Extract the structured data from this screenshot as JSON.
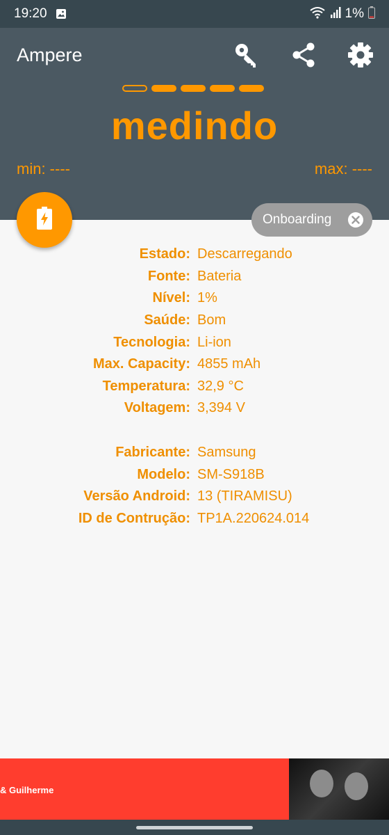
{
  "status_bar": {
    "time": "19:20",
    "battery_percent": "1%"
  },
  "header": {
    "app_title": "Ampere",
    "icons": [
      "key-icon",
      "share-icon",
      "gear-icon"
    ],
    "progress": {
      "filled": 4,
      "total": 5
    },
    "status_word": "medindo",
    "min_label": "min: ----",
    "max_label": "max: ----"
  },
  "fab": {
    "icon": "battery-charging-icon"
  },
  "chip": {
    "label": "Onboarding",
    "icon": "close-circle-icon"
  },
  "battery_info": [
    {
      "label": "Estado:",
      "value": "Descarregando"
    },
    {
      "label": "Fonte:",
      "value": "Bateria"
    },
    {
      "label": "Nível:",
      "value": "1%"
    },
    {
      "label": "Saúde:",
      "value": "Bom"
    },
    {
      "label": "Tecnologia:",
      "value": "Li-ion"
    },
    {
      "label": "Max. Capacity:",
      "value": "4855 mAh"
    },
    {
      "label": "Temperatura:",
      "value": "32,9 °C"
    },
    {
      "label": "Voltagem:",
      "value": "3,394 V"
    }
  ],
  "device_info": [
    {
      "label": "Fabricante:",
      "value": "Samsung"
    },
    {
      "label": "Modelo:",
      "value": "SM-S918B"
    },
    {
      "label": "Versão Android:",
      "value": "13 (TIRAMISU)"
    },
    {
      "label": "ID de Contrução:",
      "value": "TP1A.220624.014"
    }
  ],
  "ad": {
    "text": "& Guilherme"
  },
  "colors": {
    "accent": "#ff9800",
    "header_bg": "#4b5962",
    "status_bg": "#37474f",
    "chip_bg": "#9e9e9e",
    "ad_bg": "#ff3d2e"
  }
}
